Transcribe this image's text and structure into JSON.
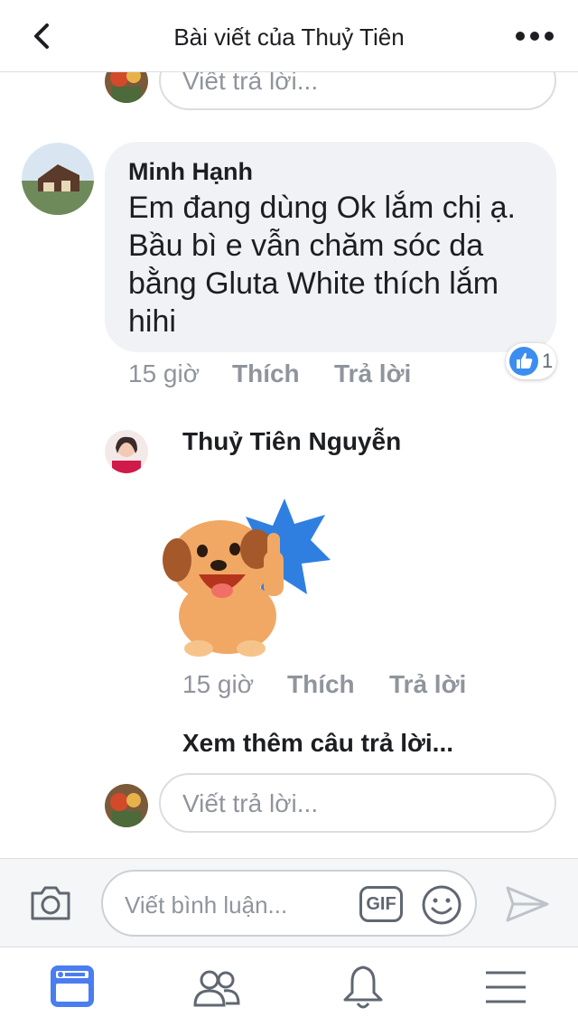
{
  "header": {
    "title": "Bài viết của Thuỷ Tiên",
    "back_icon": "chevron-left-icon",
    "more_icon": "more-horizontal-icon"
  },
  "top_reply_box": {
    "placeholder": "Viết trả lời..."
  },
  "comment_minh": {
    "author": "Minh Hạnh",
    "text": "Em đang dùng Ok lắm chị ạ. Bầu bì e vẫn chăm sóc da bằng Gluta White thích lắm hihi",
    "time": "15 giờ",
    "like_label": "Thích",
    "reply_label": "Trả lời",
    "reaction_count": "1"
  },
  "reply_thuy": {
    "author": "Thuỷ Tiên Nguyễn",
    "sticker": "dog-thumbs-up-sticker",
    "time": "15 giờ",
    "like_label": "Thích",
    "reply_label": "Trả lời"
  },
  "more_replies_label": "Xem thêm câu trả lời...",
  "bottom_reply_box": {
    "placeholder": "Viết trả lời..."
  },
  "composer": {
    "placeholder": "Viết bình luận...",
    "gif_label": "GIF",
    "camera_icon": "camera-icon",
    "emoji_icon": "emoji-icon",
    "send_icon": "send-icon"
  },
  "tabbar": {
    "items": [
      "news-feed-icon",
      "friends-icon",
      "notifications-icon",
      "menu-icon"
    ]
  },
  "colors": {
    "accent": "#4a7df0",
    "bubble": "#f0f2f5",
    "muted": "#90949c"
  }
}
